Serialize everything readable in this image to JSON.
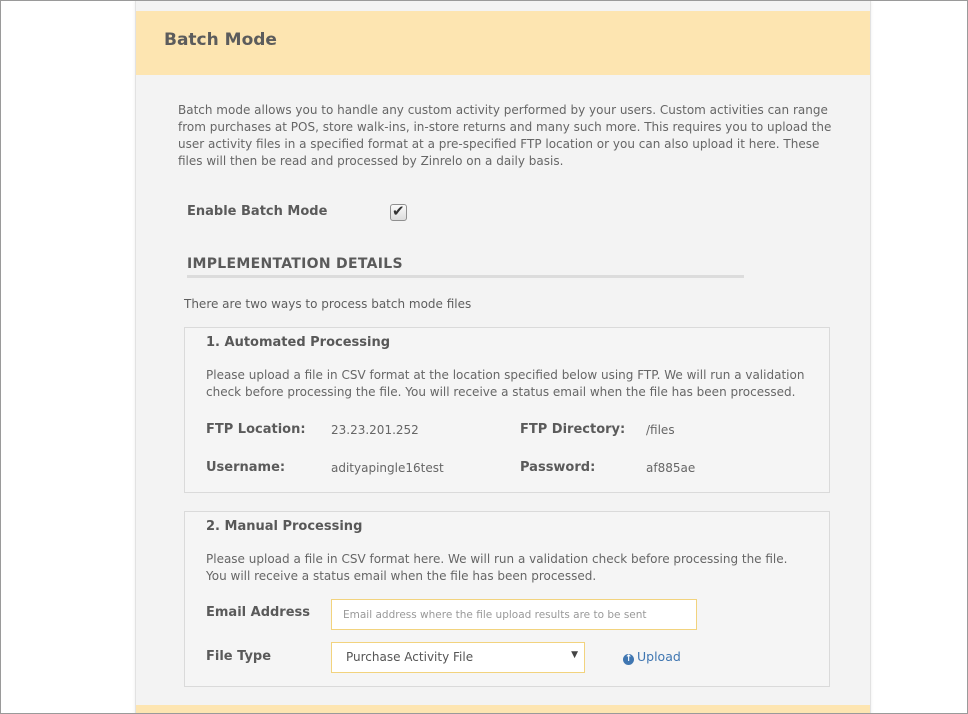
{
  "header": {
    "title": "Batch Mode"
  },
  "intro": "Batch mode allows you to handle any custom activity performed by your users. Custom activities can range from purchases at POS, store walk-ins, in-store returns and many such more. This requires you to upload the user activity files in a specified format at a pre-specified FTP location or you can also upload it here. These files will then be read and processed by Zinrelo on a daily basis.",
  "enable": {
    "label": "Enable Batch Mode",
    "checked": true
  },
  "implementation": {
    "title": "IMPLEMENTATION DETAILS",
    "subtitle": "There are two ways to process batch mode files"
  },
  "automated": {
    "title": "1. Automated Processing",
    "description": "Please upload a file in CSV format at the location specified below using FTP. We will run a validation check before processing the file. You will receive a status email when the file has been processed.",
    "ftp_location_label": "FTP Location:",
    "ftp_location_value": "23.23.201.252",
    "ftp_directory_label": "FTP Directory:",
    "ftp_directory_value": "/files",
    "username_label": "Username:",
    "username_value": "adityapingle16test",
    "password_label": "Password:",
    "password_value": "af885ae"
  },
  "manual": {
    "title": "2. Manual Processing",
    "description": "Please upload a file in CSV format here. We will run a validation check before processing the file. You will receive a status email when the file has been processed.",
    "email_label": "Email Address",
    "email_value": "",
    "email_placeholder": "Email address where the file upload results are to be sent",
    "file_type_label": "File Type",
    "file_type_selected": "Purchase Activity File",
    "upload_label": "Upload"
  },
  "colors": {
    "header_bg": "#fde5b1",
    "link": "#3f76b1",
    "input_border": "#f2d37e"
  }
}
